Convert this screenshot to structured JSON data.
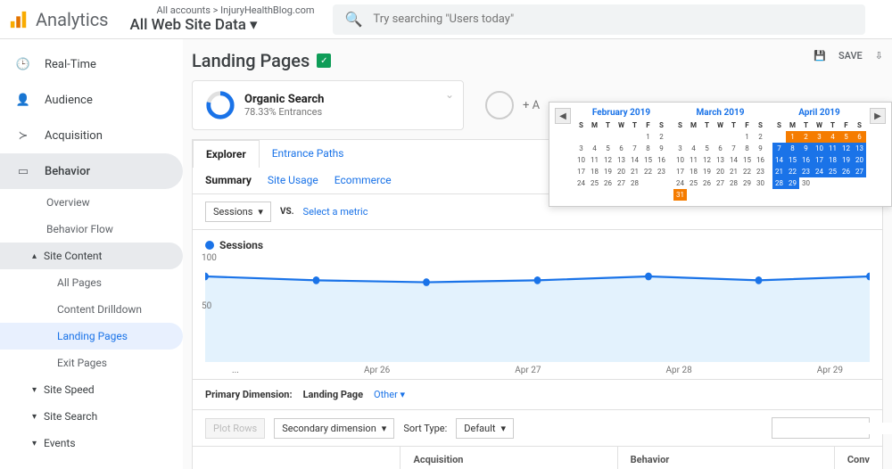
{
  "header": {
    "brand": "Analytics",
    "breadcrumb": "All accounts > InjuryHealthBlog.com",
    "view": "All Web Site Data",
    "search_placeholder": "Try searching \"Users today\""
  },
  "actions": {
    "save": "SAVE"
  },
  "sidebar": {
    "items": [
      {
        "label": "Real-Time",
        "icon": "clock"
      },
      {
        "label": "Audience",
        "icon": "person"
      },
      {
        "label": "Acquisition",
        "icon": "share"
      },
      {
        "label": "Behavior",
        "icon": "grid"
      }
    ],
    "behavior_children": [
      "Overview",
      "Behavior Flow"
    ],
    "site_content": {
      "label": "Site Content",
      "children": [
        "All Pages",
        "Content Drilldown",
        "Landing Pages",
        "Exit Pages"
      ]
    },
    "collapsed": [
      "Site Speed",
      "Site Search",
      "Events"
    ]
  },
  "page": {
    "title": "Landing Pages"
  },
  "segment": {
    "name": "Organic Search",
    "sub": "78.33% Entrances",
    "add": "+ A"
  },
  "tabs": {
    "explorer": "Explorer",
    "entrance": "Entrance Paths"
  },
  "subtabs": {
    "summary": "Summary",
    "site_usage": "Site Usage",
    "ecommerce": "Ecommerce"
  },
  "metrics": {
    "primary": "Sessions",
    "vs": "VS.",
    "select": "Select a metric",
    "legend": "Sessions"
  },
  "chart_data": {
    "type": "line",
    "x": [
      "...",
      "Apr 26",
      "Apr 27",
      "Apr 28",
      "Apr 29"
    ],
    "y_ticks": [
      50,
      100
    ],
    "series": [
      {
        "name": "Sessions",
        "values": [
          88,
          84,
          82,
          84,
          88,
          84,
          88
        ]
      }
    ],
    "ylim": [
      0,
      100
    ]
  },
  "dimension": {
    "label": "Primary Dimension:",
    "value": "Landing Page",
    "other": "Other"
  },
  "controls": {
    "plot": "Plot Rows",
    "secondary": "Secondary dimension",
    "sort_label": "Sort Type:",
    "sort": "Default"
  },
  "table": {
    "cols": [
      "",
      "Acquisition",
      "Behavior",
      "Conv"
    ]
  },
  "datepicker": {
    "months": [
      {
        "name": "February 2019",
        "start_dow": 5,
        "days": 28,
        "hl": [],
        "h2": []
      },
      {
        "name": "March 2019",
        "start_dow": 5,
        "days": 31,
        "hl": [],
        "h2": [
          31
        ]
      },
      {
        "name": "April 2019",
        "start_dow": 1,
        "days": 30,
        "hl": [
          7,
          8,
          9,
          10,
          11,
          12,
          13,
          14,
          15,
          16,
          17,
          18,
          19,
          20,
          21,
          22,
          23,
          24,
          25,
          26,
          27,
          28,
          29
        ],
        "h2": [
          1,
          2,
          3,
          4,
          5,
          6
        ]
      }
    ],
    "dows": [
      "S",
      "M",
      "T",
      "W",
      "T",
      "F",
      "S"
    ]
  }
}
